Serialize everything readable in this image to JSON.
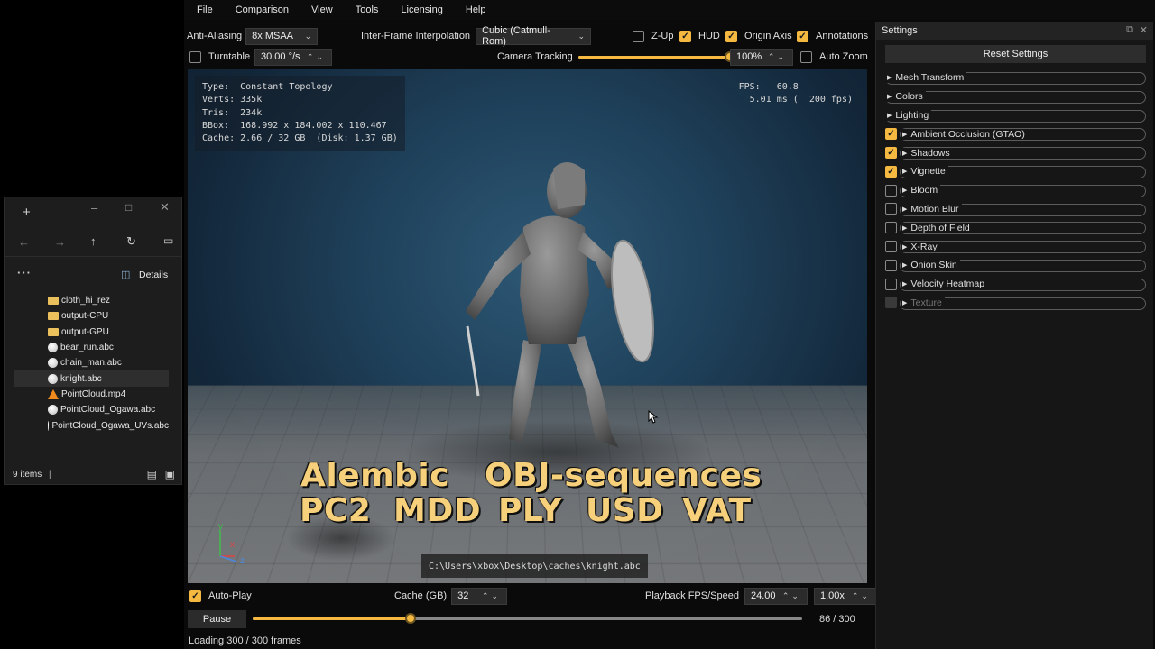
{
  "menu": [
    "File",
    "Comparison",
    "View",
    "Tools",
    "Licensing",
    "Help"
  ],
  "toolbar": {
    "anti_aliasing_label": "Anti-Aliasing",
    "anti_aliasing_value": "8x MSAA",
    "interp_label": "Inter-Frame Interpolation",
    "interp_value": "Cubic (Catmull-Rom)",
    "zup_label": "Z-Up",
    "hud_label": "HUD",
    "origin_axis_label": "Origin Axis",
    "annotations_label": "Annotations",
    "turntable_label": "Turntable",
    "turntable_value": "30.00 °/s",
    "camera_tracking_label": "Camera Tracking",
    "camera_tracking_level": 0.98,
    "zoom_value": "100%",
    "auto_zoom_label": "Auto Zoom"
  },
  "hud": {
    "stats": "Type:  Constant Topology\nVerts: 335k\nTris:  234k\nBBox:  168.992 x 184.002 x 110.467\nCache: 2.66 / 32 GB  (Disk: 1.37 GB)",
    "fps": "FPS:   60.8\n  5.01 ms (  200 fps)"
  },
  "formats": {
    "line1a": "Alembic",
    "line1b": "OBJ-sequences",
    "line2": [
      "PC2",
      "MDD",
      "PLY",
      "USD",
      "VAT"
    ]
  },
  "axis": {
    "y": "y",
    "x": "x",
    "z": "z"
  },
  "file_path": "C:\\Users\\xbox\\Desktop\\caches\\knight.abc",
  "bottom": {
    "autoplay_label": "Auto-Play",
    "cache_label": "Cache (GB)",
    "cache_value": "32",
    "playback_label": "Playback FPS/Speed",
    "fps_value": "24.00",
    "speed_value": "1.00x",
    "pause_label": "Pause",
    "frame_counter": "86 / 300",
    "timeline_position": 0.287,
    "status": "Loading 300 / 300 frames"
  },
  "settings": {
    "title": "Settings",
    "reset_label": "Reset Settings",
    "sections": [
      {
        "label": "Mesh Transform",
        "checkbox": null
      },
      {
        "label": "Colors",
        "checkbox": null
      },
      {
        "label": "Lighting",
        "checkbox": null
      },
      {
        "label": "Ambient Occlusion (GTAO)",
        "checkbox": true
      },
      {
        "label": "Shadows",
        "checkbox": true
      },
      {
        "label": "Vignette",
        "checkbox": true
      },
      {
        "label": "Bloom",
        "checkbox": false
      },
      {
        "label": "Motion Blur",
        "checkbox": false
      },
      {
        "label": "Depth of Field",
        "checkbox": false
      },
      {
        "label": "X-Ray",
        "checkbox": false
      },
      {
        "label": "Onion Skin",
        "checkbox": false
      },
      {
        "label": "Velocity Heatmap",
        "checkbox": false
      },
      {
        "label": "Texture",
        "checkbox": "disabled"
      }
    ]
  },
  "explorer": {
    "details_label": "Details",
    "files": [
      {
        "name": "cloth_hi_rez",
        "icon": "folder-icon"
      },
      {
        "name": "output-CPU",
        "icon": "folder-icon"
      },
      {
        "name": "output-GPU",
        "icon": "folder-icon"
      },
      {
        "name": "bear_run.abc",
        "icon": "abc-file-icon"
      },
      {
        "name": "chain_man.abc",
        "icon": "abc-file-icon"
      },
      {
        "name": "knight.abc",
        "icon": "abc-file-icon",
        "selected": true
      },
      {
        "name": "PointCloud.mp4",
        "icon": "vlc-icon"
      },
      {
        "name": "PointCloud_Ogawa.abc",
        "icon": "abc-file-icon"
      },
      {
        "name": "PointCloud_Ogawa_UVs.abc",
        "icon": "abc-file-icon"
      }
    ],
    "status": "9 items"
  },
  "colors": {
    "accent": "#f5b942",
    "panel": "#161616",
    "viewport_bg": "#1e3f58"
  }
}
